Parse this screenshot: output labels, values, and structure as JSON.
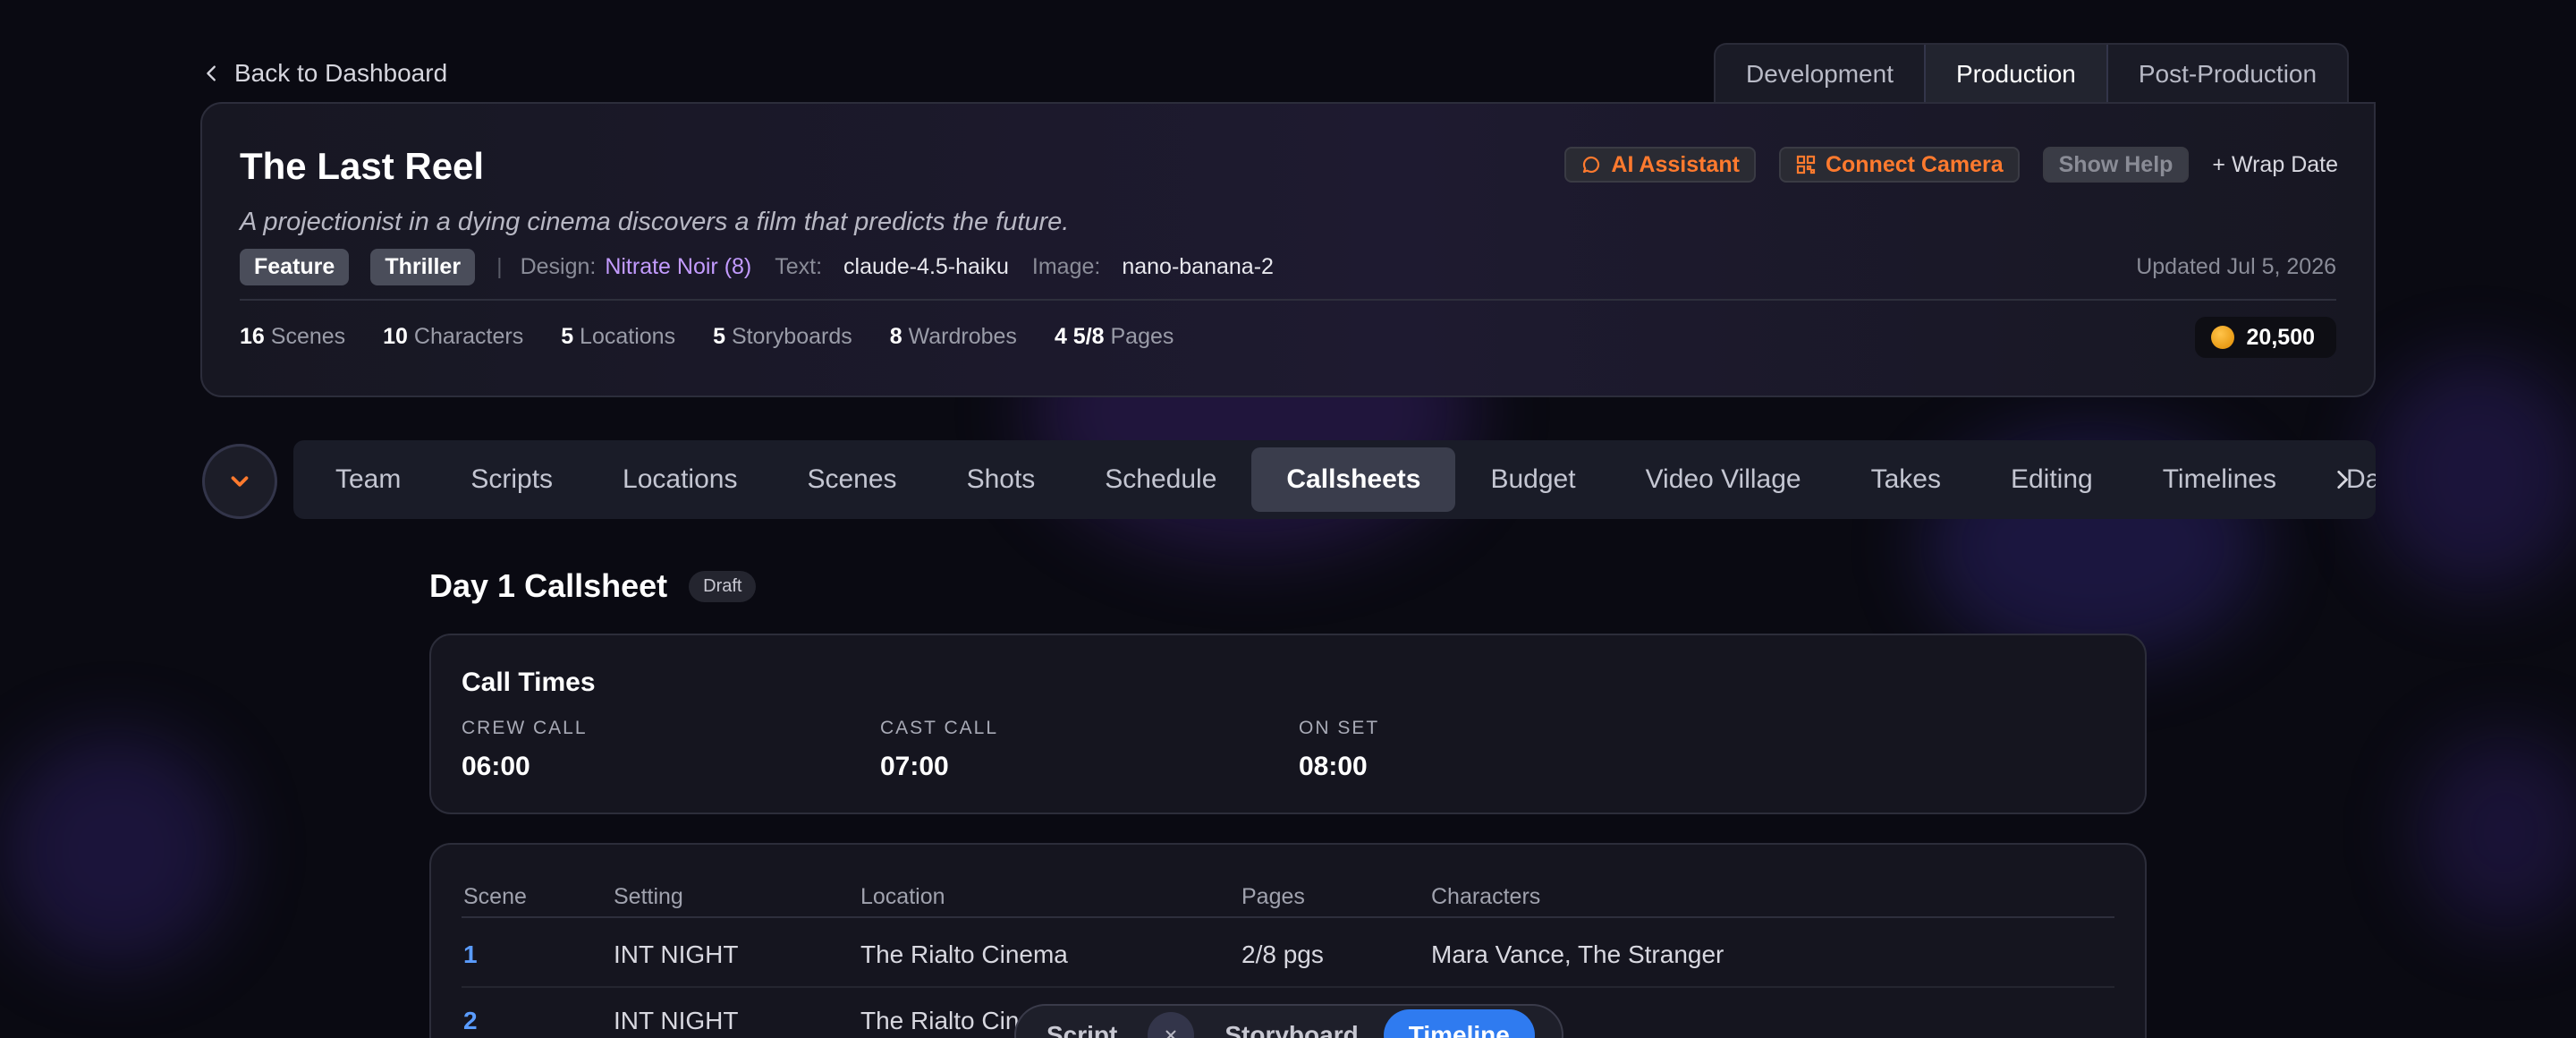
{
  "nav": {
    "back_label": "Back to Dashboard"
  },
  "phases": [
    {
      "label": "Development",
      "active": false
    },
    {
      "label": "Production",
      "active": true
    },
    {
      "label": "Post-Production",
      "active": false
    }
  ],
  "project": {
    "title": "The Last Reel",
    "logline": "A projectionist in a dying cinema discovers a film that predicts the future.",
    "tags": [
      "Feature",
      "Thriller"
    ],
    "design_label": "Design:",
    "design_value": "Nitrate Noir (8)",
    "text_label": "Text:",
    "text_value": "claude-4.5-haiku",
    "image_label": "Image:",
    "image_value": "nano-banana-2",
    "updated": "Updated Jul 5, 2026",
    "actions": {
      "ai_assistant": "AI Assistant",
      "connect_camera": "Connect Camera",
      "show_help": "Show Help",
      "wrap_date": "+ Wrap Date"
    },
    "stats": [
      {
        "count": "16",
        "label": "Scenes"
      },
      {
        "count": "10",
        "label": "Characters"
      },
      {
        "count": "5",
        "label": "Locations"
      },
      {
        "count": "5",
        "label": "Storyboards"
      },
      {
        "count": "8",
        "label": "Wardrobes"
      },
      {
        "count": "4 5/8",
        "label": "Pages"
      }
    ],
    "credits": "20,500"
  },
  "section_tabs": [
    "Team",
    "Scripts",
    "Locations",
    "Scenes",
    "Shots",
    "Schedule",
    "Callsheets",
    "Budget",
    "Video Village",
    "Takes",
    "Editing",
    "Timelines",
    "Data"
  ],
  "active_section": "Callsheets",
  "callsheet": {
    "title": "Day 1 Callsheet",
    "status": "Draft",
    "call_times_title": "Call Times",
    "calls": [
      {
        "label": "CREW CALL",
        "time": "06:00"
      },
      {
        "label": "CAST CALL",
        "time": "07:00"
      },
      {
        "label": "ON SET",
        "time": "08:00"
      }
    ],
    "columns": [
      "Scene",
      "Setting",
      "Location",
      "Pages",
      "Characters"
    ],
    "rows": [
      {
        "scene": "1",
        "setting": "INT NIGHT",
        "location": "The Rialto Cinema",
        "pages": "2/8 pgs",
        "characters": "Mara Vance, The Stranger"
      },
      {
        "scene": "2",
        "setting": "INT NIGHT",
        "location": "The Rialto Cinema",
        "pages": "",
        "characters": ""
      }
    ]
  },
  "view_switch": {
    "items": [
      "Script",
      "Storyboard",
      "Timeline"
    ],
    "active": "Timeline"
  },
  "colors": {
    "accent_orange": "#ff7a2e",
    "accent_purple": "#c39bff",
    "accent_blue": "#2f7bf0",
    "link_blue": "#5a9cff"
  }
}
